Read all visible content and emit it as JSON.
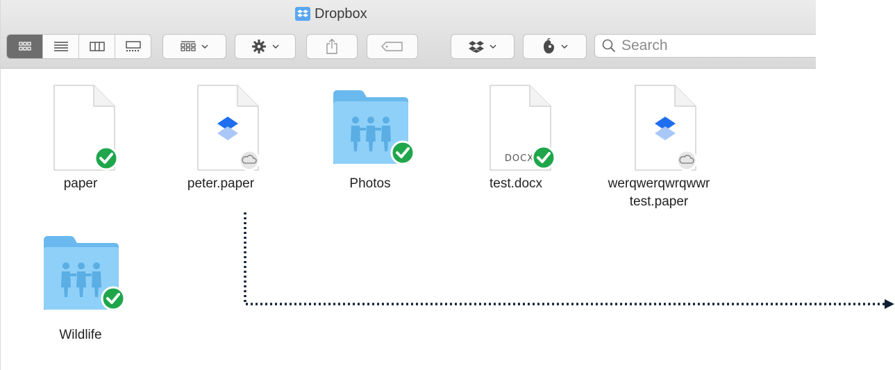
{
  "window": {
    "title": "Dropbox"
  },
  "toolbar": {
    "view_modes": [
      "icon-view",
      "list-view",
      "column-view",
      "gallery-view"
    ],
    "active_view": "icon-view",
    "search_placeholder": "Search"
  },
  "files": [
    {
      "name_line1": "paper",
      "name_line2": "",
      "kind": "document",
      "status": "synced"
    },
    {
      "name_line1": "peter.paper",
      "name_line2": "",
      "kind": "dropbox-paper",
      "status": "online-only"
    },
    {
      "name_line1": "Photos",
      "name_line2": "",
      "kind": "shared-folder",
      "status": "synced"
    },
    {
      "name_line1": "test.docx",
      "name_line2": "",
      "kind": "docx",
      "badge_text": "DOCX",
      "status": "synced"
    },
    {
      "name_line1": "werqwerqwrqwwr",
      "name_line2": "test.paper",
      "kind": "dropbox-paper",
      "status": "online-only"
    },
    {
      "name_line1": "Wildlife",
      "name_line2": "",
      "kind": "shared-folder",
      "status": "synced"
    }
  ],
  "colors": {
    "synced_badge": "#1fa64b",
    "folder": "#7cc8f5",
    "dropbox_blue": "#1f6ef0",
    "arrow": "#0f1f33"
  }
}
